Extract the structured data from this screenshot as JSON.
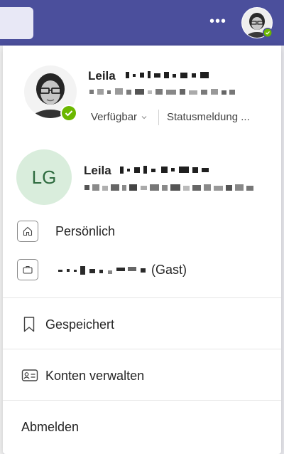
{
  "profile": {
    "first_name": "Leila",
    "availability": "Verfügbar",
    "status_message": "Statusmeldung ..."
  },
  "account": {
    "initials": "LG",
    "first_name": "Leila"
  },
  "menu": {
    "personal": "Persönlich",
    "guest_suffix": "(Gast)",
    "saved": "Gespeichert",
    "manage_accounts": "Konten verwalten",
    "sign_out": "Abmelden"
  },
  "colors": {
    "header": "#4b4f9c",
    "presence_available": "#6bb700",
    "initials_bg": "#d9eddc",
    "initials_text": "#2e6b3f"
  },
  "icons": {
    "more": "more-dots-icon",
    "home": "home-icon",
    "work": "briefcase-icon",
    "saved": "bookmark-icon",
    "accounts": "contact-card-icon",
    "chevron": "chevron-down-icon",
    "presence": "checkmark-icon"
  }
}
